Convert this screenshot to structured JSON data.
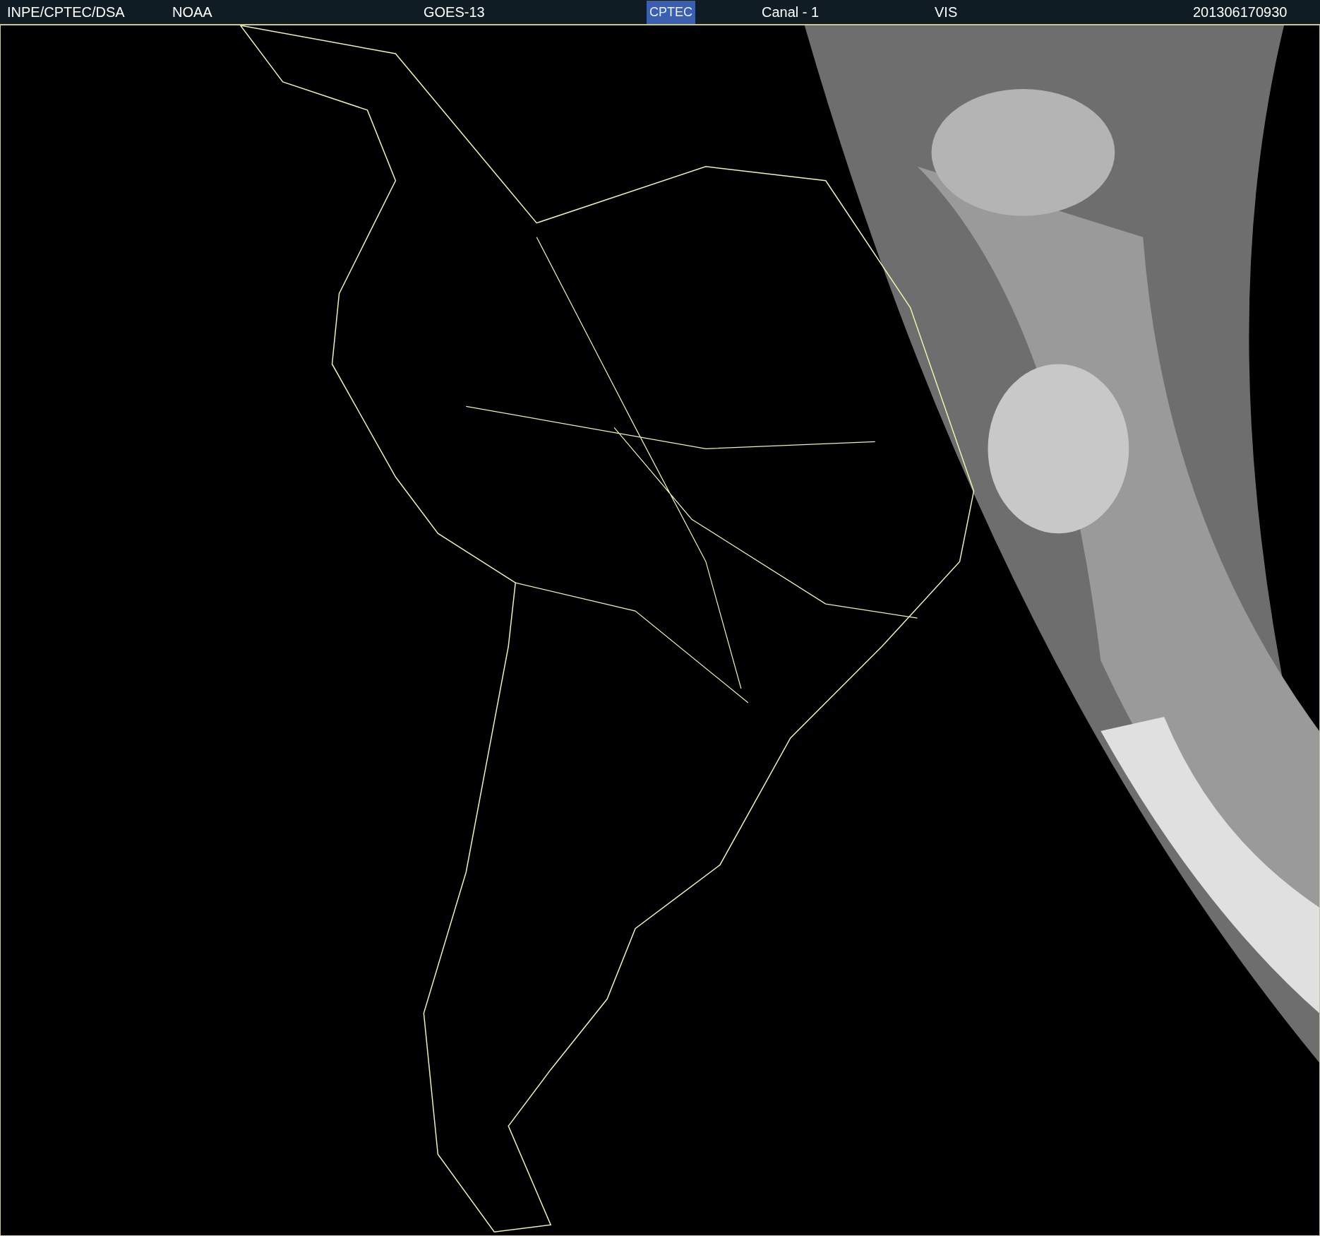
{
  "header": {
    "source": "INPE/CPTEC/DSA",
    "agency": "NOAA",
    "satellite": "GOES-13",
    "logo": "CPTEC",
    "channel": "Canal - 1",
    "band": "VIS",
    "timestamp": "201306170930"
  }
}
